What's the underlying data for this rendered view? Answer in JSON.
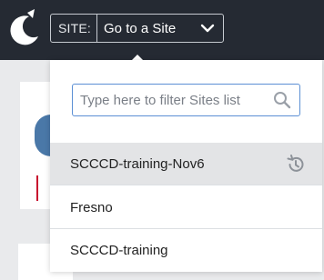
{
  "header": {
    "site_label": "SITE:",
    "site_value": "Go to a Site"
  },
  "dropdown": {
    "filter_placeholder": "Type here to filter Sites list",
    "items": [
      {
        "label": "SCCCD-training-Nov6",
        "selected": true,
        "icon": "history-icon"
      },
      {
        "label": "Fresno",
        "selected": false
      },
      {
        "label": "SCCCD-training",
        "selected": false
      }
    ]
  },
  "colors": {
    "topbar": "#252a33",
    "accent_border": "#5b8fd4",
    "selected_row": "#e3e4e6"
  }
}
